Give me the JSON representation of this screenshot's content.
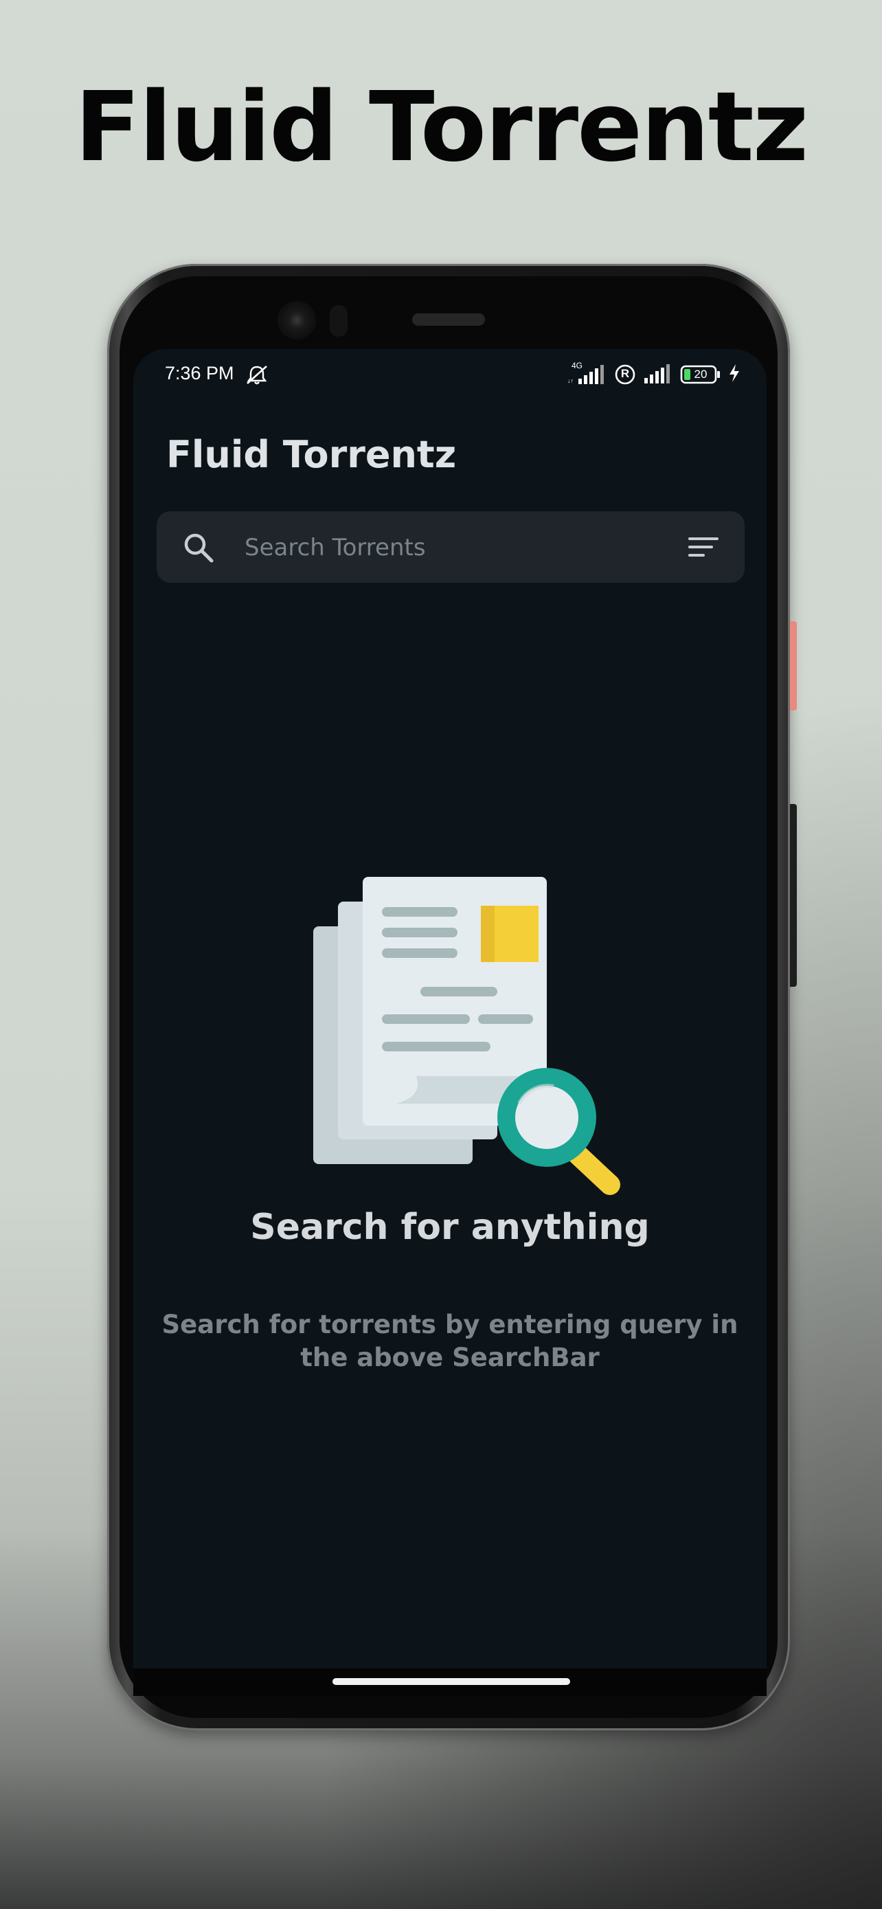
{
  "promo": {
    "title": "Fluid Torrentz"
  },
  "status_bar": {
    "time": "7:36 PM",
    "network_type": "4G",
    "roaming_badge": "R",
    "battery_level": "20",
    "icons": [
      "dnd-bell-off-icon",
      "signal-icon",
      "roaming-icon",
      "signal-icon",
      "battery-icon",
      "charging-bolt-icon"
    ]
  },
  "app": {
    "title": "Fluid Torrentz",
    "search": {
      "placeholder": "Search Torrents",
      "value": "",
      "icon": "search-icon",
      "filter_icon": "filter-list-icon"
    },
    "empty_state": {
      "illustration": "documents-magnifier-illustration",
      "title": "Search for anything",
      "subtitle": "Search for torrents by entering query in the above SearchBar"
    }
  },
  "colors": {
    "background": "#0d1419",
    "search_bar": "#1f252b",
    "title_text": "#dfe3e6",
    "subtitle_text": "#7c858b",
    "accent_teal": "#1aa594",
    "accent_yellow": "#f5cf37"
  }
}
